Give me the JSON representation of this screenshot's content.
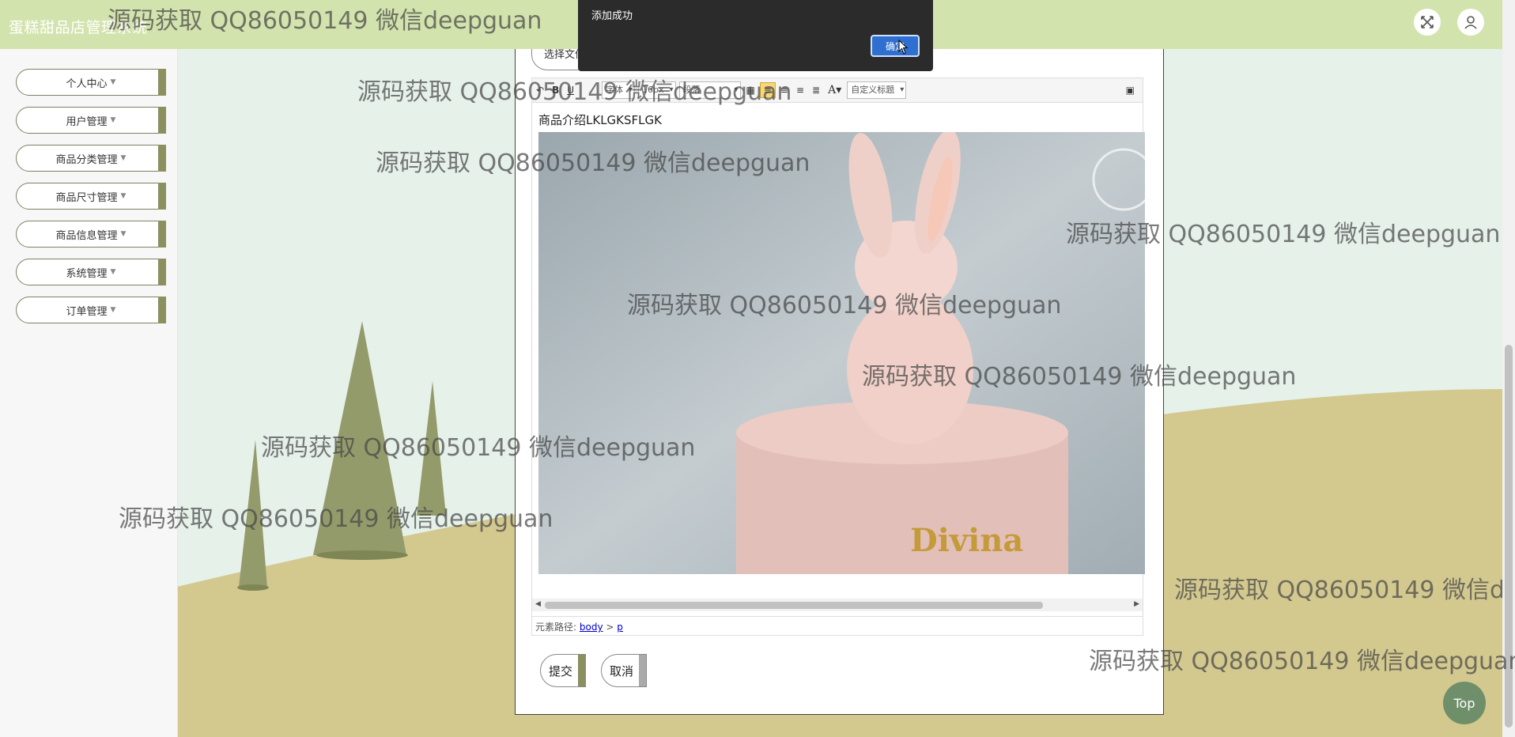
{
  "header": {
    "brand": "蛋糕甜品店管理系统",
    "fullscreen_icon": "expand-icon",
    "user_icon": "user-icon"
  },
  "sidebar": {
    "items": [
      {
        "label": "个人中心"
      },
      {
        "label": "用户管理"
      },
      {
        "label": "商品分类管理"
      },
      {
        "label": "商品尺寸管理"
      },
      {
        "label": "商品信息管理"
      },
      {
        "label": "系统管理"
      },
      {
        "label": "订单管理"
      }
    ]
  },
  "modal": {
    "file_button": "选择文件",
    "toolbar": {
      "font_family": "字体",
      "font_size": "16px",
      "paragraph": "段落",
      "custom_title": "自定义标题"
    },
    "editor_text": "商品介绍LKLGKSFLGK",
    "image_text": "Divina",
    "element_path_label": "元素路径:",
    "element_path_body": "body",
    "element_path_sep": ">",
    "element_path_p": "p",
    "submit": "提交",
    "cancel": "取消"
  },
  "alert": {
    "message": "添加成功",
    "ok": "确定"
  },
  "top_button": "Top",
  "watermark": "源码获取 QQ86050149 微信deepguan",
  "colors": {
    "header_bg": "#d3e3ad",
    "menu_accent": "#8a9060",
    "alert_bg": "#2b2b2b",
    "alert_ok": "#2f6fcf",
    "top_button": "#6f8f6b"
  }
}
